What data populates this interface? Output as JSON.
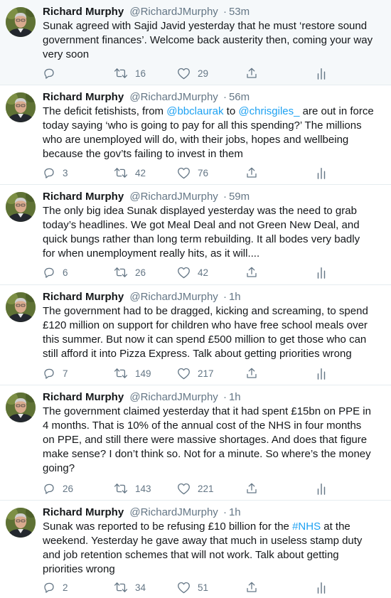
{
  "tweets": [
    {
      "name": "Richard Murphy",
      "handle": "@RichardJMurphy",
      "sep": "·",
      "time": "53m",
      "lines": [
        [
          {
            "t": "Sunak agreed with Sajid Javid yesterday that he must ‘restore sound"
          }
        ],
        [
          {
            "t": "government finances’. Welcome back austerity then, coming your way"
          }
        ],
        [
          {
            "t": "very soon"
          }
        ]
      ],
      "replies": "",
      "retweets": "16",
      "likes": "29"
    },
    {
      "name": "Richard Murphy",
      "handle": "@RichardJMurphy",
      "sep": "·",
      "time": "56m",
      "lines": [
        [
          {
            "t": "The deficit fetishists, from "
          },
          {
            "t": "@bbclaurak",
            "link": true
          },
          {
            "t": " to "
          },
          {
            "t": "@chrisgiles_",
            "link": true
          },
          {
            "t": " are out in force"
          }
        ],
        [
          {
            "t": "today saying ‘who is going to pay for all this spending?’ The millions"
          }
        ],
        [
          {
            "t": "who are unemployed will do, with their jobs, hopes and wellbeing"
          }
        ],
        [
          {
            "t": "because the gov’ts failing to invest in them"
          }
        ]
      ],
      "replies": "3",
      "retweets": "42",
      "likes": "76"
    },
    {
      "name": "Richard Murphy",
      "handle": "@RichardJMurphy",
      "sep": "·",
      "time": "59m",
      "lines": [
        [
          {
            "t": "The only big idea Sunak displayed yesterday was the need to grab"
          }
        ],
        [
          {
            "t": "today’s headlines. We got Meal Deal and not Green New Deal, and"
          }
        ],
        [
          {
            "t": "quick bungs rather than long term rebuilding. It all bodes very badly"
          }
        ],
        [
          {
            "t": "for when unemployment really hits, as it will...."
          }
        ]
      ],
      "replies": "6",
      "retweets": "26",
      "likes": "42"
    },
    {
      "name": "Richard Murphy",
      "handle": "@RichardJMurphy",
      "sep": "·",
      "time": "1h",
      "lines": [
        [
          {
            "t": "The government had to be dragged, kicking and screaming, to spend"
          }
        ],
        [
          {
            "t": "£120 million on support for children who have free school meals over"
          }
        ],
        [
          {
            "t": "this summer. But now it can spend £500 million to get those who can"
          }
        ],
        [
          {
            "t": "still afford it into Pizza Express. Talk about getting priorities wrong"
          }
        ]
      ],
      "replies": "7",
      "retweets": "149",
      "likes": "217"
    },
    {
      "name": "Richard Murphy",
      "handle": "@RichardJMurphy",
      "sep": "·",
      "time": "1h",
      "lines": [
        [
          {
            "t": "The government claimed yesterday that it had spent £15bn on PPE in"
          }
        ],
        [
          {
            "t": "4 months. That is 10% of the annual cost of the NHS in four months"
          }
        ],
        [
          {
            "t": "on PPE, and still there were massive shortages. And does that figure"
          }
        ],
        [
          {
            "t": "make sense? I don’t think so. Not for a minute. So where’s the money"
          }
        ],
        [
          {
            "t": "going?"
          }
        ]
      ],
      "replies": "26",
      "retweets": "143",
      "likes": "221"
    },
    {
      "name": "Richard Murphy",
      "handle": "@RichardJMurphy",
      "sep": "·",
      "time": "1h",
      "lines": [
        [
          {
            "t": "Sunak was reported to be refusing £10 billion for the "
          },
          {
            "t": "#NHS",
            "link": true
          },
          {
            "t": " at the"
          }
        ],
        [
          {
            "t": "weekend. Yesterday he gave away that much in useless stamp duty"
          }
        ],
        [
          {
            "t": "and job retention schemes that will not work. Talk about getting"
          }
        ],
        [
          {
            "t": "priorities wrong"
          }
        ]
      ],
      "replies": "2",
      "retweets": "34",
      "likes": "51"
    }
  ],
  "icons": {
    "reply": "reply-icon",
    "retweet": "retweet-icon",
    "like": "heart-icon",
    "share": "share-icon",
    "analytics": "analytics-icon"
  },
  "colors": {
    "text": "#14171a",
    "muted": "#657786",
    "link": "#1da1f2",
    "highlight_bg": "#f5f8fa",
    "divider": "#e6ecf0"
  }
}
